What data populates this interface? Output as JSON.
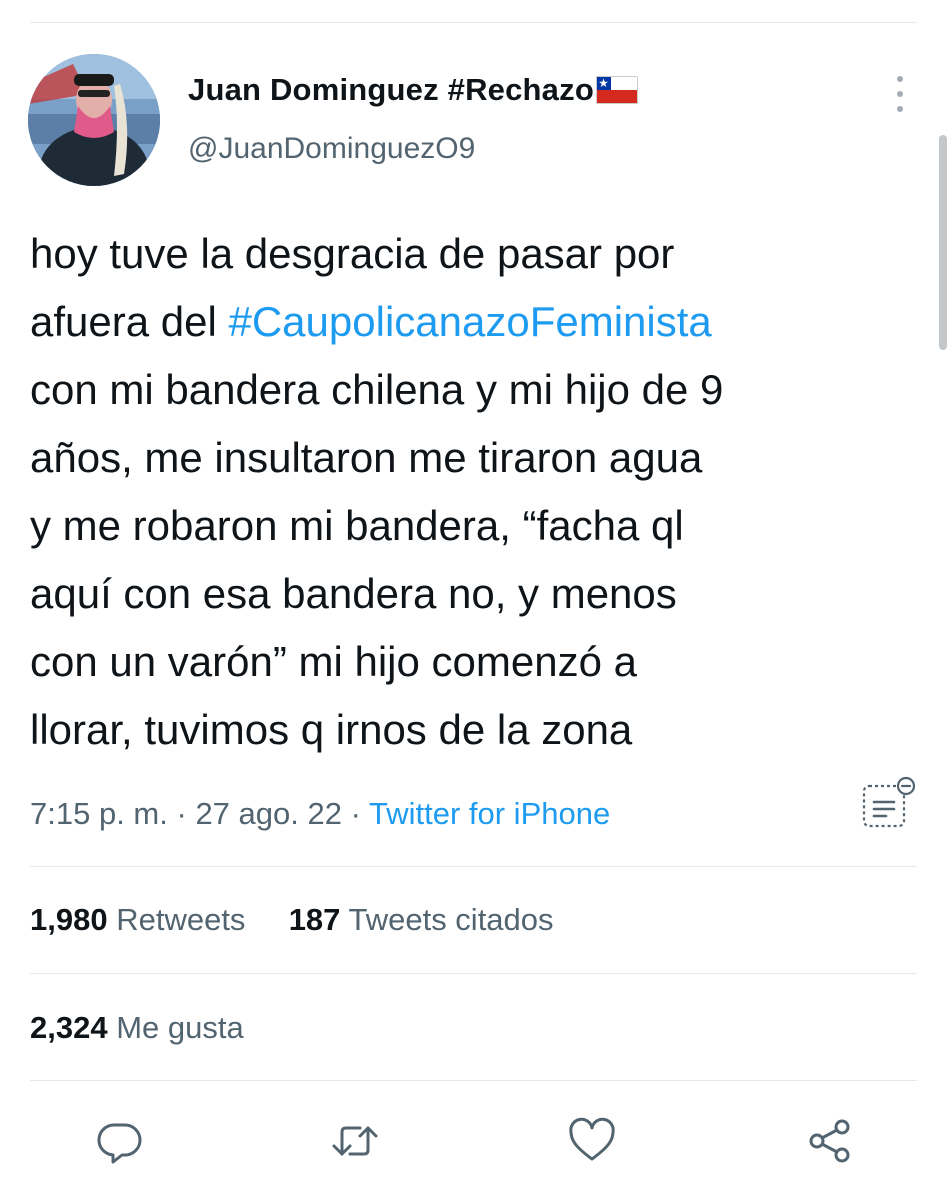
{
  "tweet": {
    "display_name": "Juan Dominguez #Rechazo",
    "handle": "@JuanDominguezO9",
    "text_lines": [
      [
        "hoy tuve la desgracia de pasar por"
      ],
      [
        "afuera del ",
        "#CaupolicanazoFeminista"
      ],
      [
        "con mi bandera chilena y mi hijo de 9"
      ],
      [
        "años, me insultaron me tiraron agua"
      ],
      [
        "y me robaron mi bandera, “facha ql"
      ],
      [
        "aquí con esa bandera no, y menos"
      ],
      [
        "con un varón” mi hijo comenzó a"
      ],
      [
        "llorar, tuvimos q irnos de la zona"
      ]
    ],
    "hashtag": "#CaupolicanazoFeminista",
    "time": "7:15 p. m.",
    "separator": "·",
    "date": "27 ago. 22",
    "source": "Twitter for iPhone"
  },
  "stats": {
    "retweets_count": "1,980",
    "retweets_label": "Retweets",
    "quotes_count": "187",
    "quotes_label": "Tweets citados",
    "likes_count": "2,324",
    "likes_label": "Me gusta"
  },
  "icons": {
    "more": "more-vertical-icon",
    "analytics": "analytics-icon",
    "reply": "reply-icon",
    "retweet": "retweet-icon",
    "like": "like-icon",
    "share": "share-icon",
    "flag": "chile-flag-icon"
  },
  "colors": {
    "link": "#1d9bf0",
    "secondary_text": "#536471",
    "primary_text": "#0f1419",
    "divider": "#e6e9ec"
  }
}
